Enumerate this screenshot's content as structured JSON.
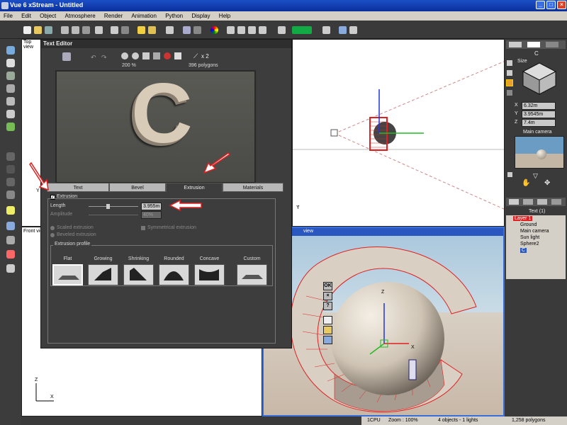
{
  "window": {
    "title": "Vue 6 xStream - Untitled",
    "minimize": "_",
    "maximize": "□",
    "close": "×"
  },
  "menu": [
    "File",
    "Edit",
    "Object",
    "Atmosphere",
    "Render",
    "Animation",
    "Python",
    "Display",
    "Help"
  ],
  "viewports": {
    "top": "Top view",
    "front": "Front view",
    "main_suffix": "view",
    "axis_y": "Y",
    "axis_z": "Z",
    "axis_x": "X"
  },
  "text_editor": {
    "title": "Text Editor",
    "zoom": "200 %",
    "polygons": "396 polygons",
    "multiplier": "x 2",
    "preview_char": "C",
    "tabs": [
      "Text",
      "Bevel",
      "Extrusion",
      "Materials"
    ],
    "active_tab": "Extrusion",
    "extrusion": {
      "section_label": "Extrusion",
      "checked": true,
      "length_label": "Length",
      "length_value": "3.955m",
      "amplitude_label": "Amplitude",
      "amplitude_value": "40%",
      "scaled_label": "Scaled extrusion",
      "beveled_label": "Beveled extrusion",
      "symmetrical_label": "Symmetrical extrusion",
      "profile_label": "Extrusion profile",
      "profiles": [
        "Flat",
        "Growing",
        "Shrinking",
        "Rounded",
        "Concave",
        "Custom"
      ]
    },
    "side_buttons": [
      "OK",
      "×",
      "?"
    ]
  },
  "right_panel": {
    "object_label": "C",
    "size_label": "Size",
    "x_label": "X",
    "x_value": "6.32m",
    "y_label": "Y",
    "y_value": "3.9545m",
    "z_label": "Z",
    "z_value": "7.4m",
    "camera_label": "Main camera",
    "text_count": "Text (1)",
    "layer": "Layer 1",
    "items": [
      "Ground",
      "Main camera",
      "Sun light",
      "Sphere2",
      "C"
    ]
  },
  "status": {
    "cpu": "1CPU",
    "zoom": "Zoom : 100%",
    "objects": "4 objects - 1 lights",
    "polygons": "1,258 polygons"
  },
  "colors": {
    "accent": "#e02020",
    "titlebar": "#0a2f9c",
    "selected": "#e02020"
  }
}
